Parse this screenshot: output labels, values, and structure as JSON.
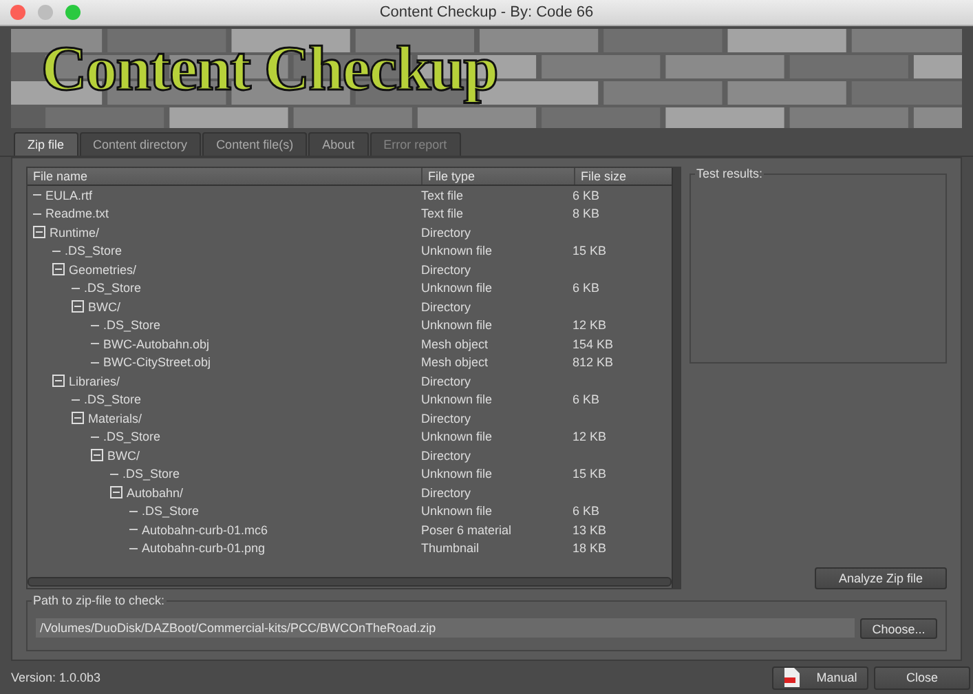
{
  "window": {
    "title": "Content Checkup - By: Code 66"
  },
  "banner": {
    "logo": "Content Checkup",
    "kind": "picture"
  },
  "tabs": [
    {
      "label": "Zip file",
      "selected": true,
      "disabled": false
    },
    {
      "label": "Content directory",
      "selected": false,
      "disabled": false
    },
    {
      "label": "Content file(s)",
      "selected": false,
      "disabled": false
    },
    {
      "label": "About",
      "selected": false,
      "disabled": false
    },
    {
      "label": "Error report",
      "selected": false,
      "disabled": true
    }
  ],
  "table": {
    "columns": [
      "File name",
      "File type",
      "File size"
    ],
    "rows": [
      {
        "name": "EULA.rtf",
        "type": "Text file",
        "size": "6 KB"
      },
      {
        "name": "Readme.txt",
        "type": "Text file",
        "size": "8 KB"
      },
      {
        "name": "Runtime/",
        "type": "Directory",
        "expanded": true,
        "children": [
          {
            "name": ".DS_Store",
            "type": "Unknown file",
            "size": "15 KB"
          },
          {
            "name": "Geometries/",
            "type": "Directory",
            "expanded": true,
            "children": [
              {
                "name": ".DS_Store",
                "type": "Unknown file",
                "size": "6 KB"
              },
              {
                "name": "BWC/",
                "type": "Directory",
                "expanded": true,
                "children": [
                  {
                    "name": ".DS_Store",
                    "type": "Unknown file",
                    "size": "12 KB"
                  },
                  {
                    "name": "BWC-Autobahn.obj",
                    "type": "Mesh object",
                    "size": "154 KB"
                  },
                  {
                    "name": "BWC-CityStreet.obj",
                    "type": "Mesh object",
                    "size": "812 KB"
                  }
                ]
              }
            ]
          },
          {
            "name": "Libraries/",
            "type": "Directory",
            "expanded": true,
            "children": [
              {
                "name": ".DS_Store",
                "type": "Unknown file",
                "size": "6 KB"
              },
              {
                "name": "Materials/",
                "type": "Directory",
                "expanded": true,
                "children": [
                  {
                    "name": ".DS_Store",
                    "type": "Unknown file",
                    "size": "12 KB"
                  },
                  {
                    "name": "BWC/",
                    "type": "Directory",
                    "expanded": true,
                    "children": [
                      {
                        "name": ".DS_Store",
                        "type": "Unknown file",
                        "size": "15 KB"
                      },
                      {
                        "name": "Autobahn/",
                        "type": "Directory",
                        "expanded": true,
                        "children": [
                          {
                            "name": ".DS_Store",
                            "type": "Unknown file",
                            "size": "6 KB"
                          },
                          {
                            "name": "Autobahn-curb-01.mc6",
                            "type": "Poser 6 material",
                            "size": "13 KB"
                          },
                          {
                            "name": "Autobahn-curb-01.png",
                            "type": "Thumbnail",
                            "size": "18 KB"
                          }
                        ]
                      }
                    ]
                  }
                ]
              }
            ]
          }
        ]
      }
    ]
  },
  "test_results": {
    "label": "Test results:"
  },
  "analyze_button": "Analyze Zip file",
  "path_group": {
    "label": "Path to zip-file to check:",
    "value": "/Volumes/DuoDisk/DAZBoot/Commercial-kits/PCC/BWCOnTheRoad.zip",
    "button": "Choose..."
  },
  "status_bar": {
    "version": "Version: 1.0.0b3"
  },
  "buttons": [
    "Manual",
    "Close"
  ]
}
